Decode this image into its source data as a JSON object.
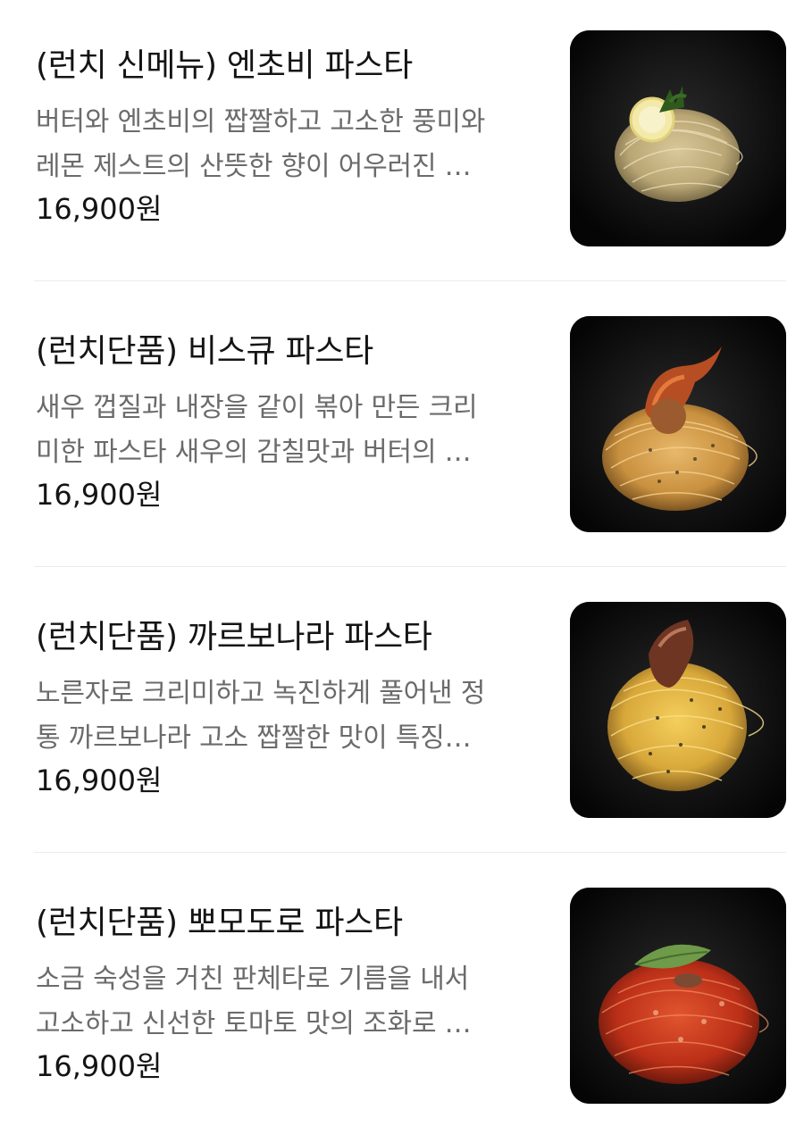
{
  "menu": {
    "items": [
      {
        "title": "(런치 신메뉴) 엔초비 파스타",
        "desc_line1": "버터와 엔초비의 짭짤하고 고소한 풍미와",
        "desc_line2": "레몬 제스트의 산뜻한 향이 어우러진 …",
        "price": "16,900원",
        "photo_icon": "anchovy-pasta-photo"
      },
      {
        "title": "(런치단품) 비스큐 파스타",
        "desc_line1": "새우 껍질과 내장을 같이 볶아 만든 크리",
        "desc_line2": "미한 파스타 새우의 감칠맛과 버터의 …",
        "price": "16,900원",
        "photo_icon": "bisque-pasta-photo"
      },
      {
        "title": "(런치단품) 까르보나라 파스타",
        "desc_line1": "노른자로 크리미하고 녹진하게 풀어낸 정",
        "desc_line2": "통 까르보나라 고소 짭짤한 맛이 특징…",
        "price": "16,900원",
        "photo_icon": "carbonara-pasta-photo"
      },
      {
        "title": "(런치단품) 뽀모도로 파스타",
        "desc_line1": "소금 숙성을 거친 판체타로 기름을 내서",
        "desc_line2": "고소하고 신선한 토마토 맛의 조화로 …",
        "price": "16,900원",
        "photo_icon": "pomodoro-pasta-photo"
      }
    ]
  },
  "colors": {
    "title": "#141414",
    "description": "#6b6b6b",
    "divider": "#ececec",
    "plate": "#0b0b0b"
  }
}
